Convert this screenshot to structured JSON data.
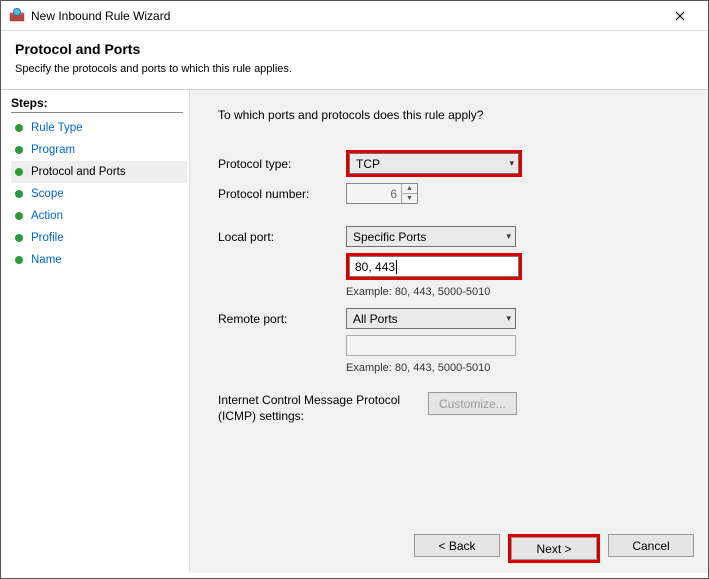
{
  "window": {
    "title": "New Inbound Rule Wizard"
  },
  "header": {
    "title": "Protocol and Ports",
    "description": "Specify the protocols and ports to which this rule applies."
  },
  "steps": {
    "title": "Steps:",
    "items": [
      {
        "label": "Rule Type"
      },
      {
        "label": "Program"
      },
      {
        "label": "Protocol and Ports"
      },
      {
        "label": "Scope"
      },
      {
        "label": "Action"
      },
      {
        "label": "Profile"
      },
      {
        "label": "Name"
      }
    ],
    "currentIndex": 2
  },
  "main": {
    "prompt": "To which ports and protocols does this rule apply?",
    "protocolTypeLabel": "Protocol type:",
    "protocolTypeValue": "TCP",
    "protocolNumberLabel": "Protocol number:",
    "protocolNumberValue": "6",
    "localPortLabel": "Local port:",
    "localPortMode": "Specific Ports",
    "localPortValue": "80, 443",
    "localPortExample": "Example: 80, 443, 5000-5010",
    "remotePortLabel": "Remote port:",
    "remotePortMode": "All Ports",
    "remotePortValue": "",
    "remotePortExample": "Example: 80, 443, 5000-5010",
    "icmpLabel": "Internet Control Message Protocol (ICMP) settings:",
    "customizeLabel": "Customize..."
  },
  "buttons": {
    "back": "< Back",
    "next": "Next >",
    "cancel": "Cancel"
  }
}
